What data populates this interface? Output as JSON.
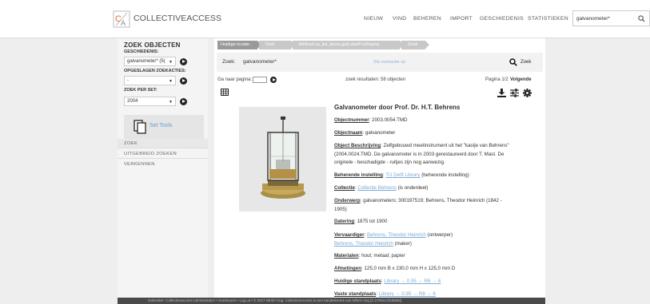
{
  "header": {
    "brand": "COLLECTIVEACCESS",
    "nav": [
      "NIEUW",
      "VIND",
      "BEHEREN",
      "IMPORT",
      "GESCHIEDENIS",
      "STATISTIEKEN"
    ],
    "search_value": "galvanometer*"
  },
  "sidebar": {
    "title": "ZOEK OBJECTEN",
    "history_label": "GESCHIEDENIS:",
    "history_value": "galvanometer* (5(",
    "saved_label": "OPGESLAGEN ZOEKACTIES:",
    "saved_value": "-",
    "set_label": "ZOEK PER SET:",
    "set_value": "2004",
    "set_tools": "Set Tools",
    "nav": [
      "ZOEK",
      "UITGEBREID ZOEKEN",
      "VERKENNEN"
    ]
  },
  "breadcrumbs": [
    "Huidige locatie",
    "Vind",
    "Method:ca_list_items.getLabelForDisplay",
    "Zoek"
  ],
  "search": {
    "label": "Zoek:",
    "value": "galvanometer*",
    "save_link": "Sla zoekactie op",
    "button": "Zoek"
  },
  "pager": {
    "goto_label": "Ga naar pagina:",
    "result_count": "zoek resultaten: 58 objecten",
    "page": "Pagina 1/2",
    "next": "Volgende"
  },
  "record": {
    "title": "Galvanometer door Prof. Dr. H.T. Behrens",
    "objectnummer_label": "Objectnummer",
    "objectnummer": "2003.0054.TMD",
    "objectnaam_label": "Objectnaam",
    "objectnaam": "galvanometer",
    "beschrijving_label": "Object Beschrijving",
    "beschrijving_1": "Zelfgebouwd meetinstrument uit het \"kastje van Behrens\"",
    "beschrijving_2": "(2004.0024.TMD. De galvanometer is in 2003 gerestaureerd door T. Mast. De",
    "beschrijving_3": "originele - beschadigde - ruitjes zijn nog aanwezig.",
    "instelling_label": "Beherende instelling",
    "instelling_link": "TU Delft Library",
    "instelling_suffix": "(beherende instelling)",
    "collectie_label": "Collectie",
    "collectie_link": "Collectie Behrens",
    "collectie_suffix": "(is onderdeel)",
    "onderwerp_label": "Onderwerp",
    "onderwerp_1": "galvanometers; 300197519; Behrens, Theodor Heinrich (1842 -",
    "onderwerp_2": "1905)",
    "datering_label": "Datering",
    "datering": "1875 tot 1900",
    "vervaardiger_label": "Vervaardiger",
    "vervaardiger_link_1": "Behrens, Theodor Heinrich",
    "vervaardiger_suffix_1": "(ontwerper)",
    "vervaardiger_link_2": "Behrens, Theodor Heinrich",
    "vervaardiger_suffix_2": "(maker)",
    "materialen_label": "Materialen",
    "materialen": "hout; metaal; papier",
    "afmetingen_label": "Afmetingen",
    "afmetingen": "125,0 mm B x 230,0 mm H x 125,0 mm D",
    "huidige_label": "Huidige standplaats",
    "huidige_link": "Library → 0.95 → R8 → 6",
    "vaste_label": "Vaste standplaats",
    "vaste_link": "Library → 0.95 → R8 → 6"
  },
  "footer": {
    "text": "Gebruiker: Collectiveaccess Administrator • Voorkeuren • Log uit • © 2017 Whirl-i-Gig. CollectiveAccess is een handelsmerk van Whirl-i-Gig [2.17/Rev.0/1550M]"
  }
}
